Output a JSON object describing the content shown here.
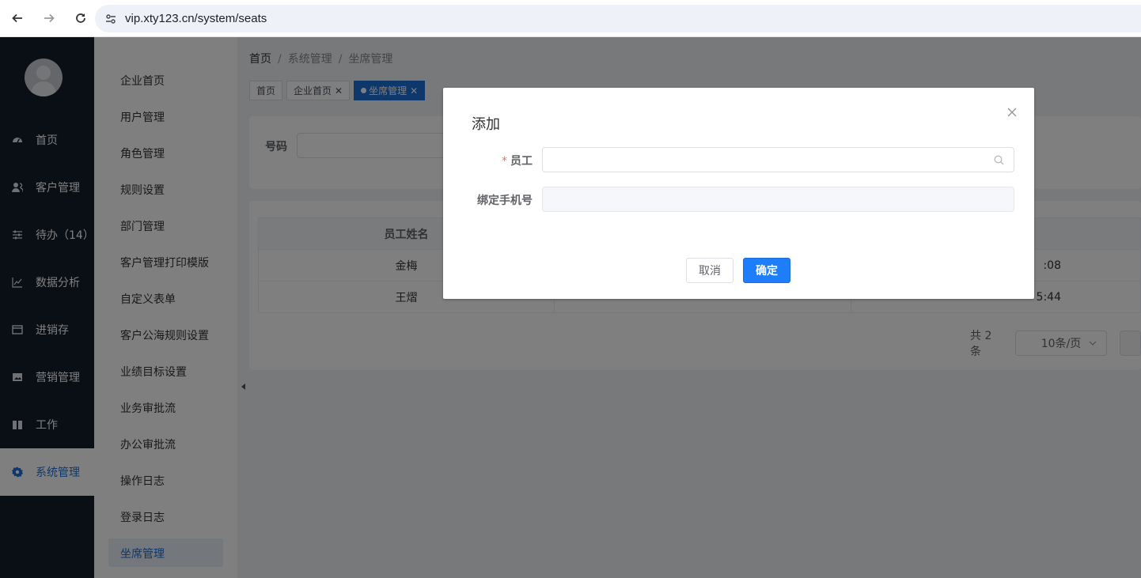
{
  "browser": {
    "url": "vip.xty123.cn/system/seats"
  },
  "primary_nav": {
    "items": [
      {
        "label": "首页",
        "icon": "dashboard-icon"
      },
      {
        "label": "客户管理",
        "icon": "users-icon"
      },
      {
        "label": "待办（14）",
        "icon": "sliders-icon"
      },
      {
        "label": "数据分析",
        "icon": "line-chart-icon"
      },
      {
        "label": "进销存",
        "icon": "folder-icon"
      },
      {
        "label": "营销管理",
        "icon": "image-icon"
      },
      {
        "label": "工作",
        "icon": "book-icon"
      },
      {
        "label": "系统管理",
        "icon": "gear-icon",
        "active": true
      }
    ]
  },
  "sub_nav": {
    "items": [
      {
        "label": "企业首页"
      },
      {
        "label": "用户管理"
      },
      {
        "label": "角色管理"
      },
      {
        "label": "规则设置"
      },
      {
        "label": "部门管理"
      },
      {
        "label": "客户管理打印模版"
      },
      {
        "label": "自定义表单"
      },
      {
        "label": "客户公海规则设置"
      },
      {
        "label": "业绩目标设置"
      },
      {
        "label": "业务审批流"
      },
      {
        "label": "办公审批流"
      },
      {
        "label": "操作日志"
      },
      {
        "label": "登录日志"
      },
      {
        "label": "坐席管理",
        "active": true
      }
    ]
  },
  "breadcrumb": {
    "home": "首页",
    "sep": "/",
    "level1": "系统管理",
    "level2": "坐席管理"
  },
  "tabs": [
    {
      "label": "首页"
    },
    {
      "label": "企业首页",
      "closable": true
    },
    {
      "label": "坐席管理",
      "closable": true,
      "active": true
    }
  ],
  "filter": {
    "label": "号码"
  },
  "table": {
    "headers": [
      "员工姓名",
      "",
      ""
    ],
    "rows": [
      [
        "金梅",
        "",
        ":08"
      ],
      [
        "王熠",
        "",
        "5:44"
      ]
    ]
  },
  "pagination": {
    "total": "共 2 条",
    "page_size": "10条/页"
  },
  "dialog": {
    "title": "添加",
    "fields": {
      "employee_label": "员工",
      "required_mark": "*",
      "employee_value": "",
      "phone_label": "绑定手机号",
      "phone_value": ""
    },
    "cancel_label": "取消",
    "confirm_label": "确定"
  },
  "colors": {
    "accent": "#1d7dfa",
    "sidebar_dark": "#141c2b"
  }
}
